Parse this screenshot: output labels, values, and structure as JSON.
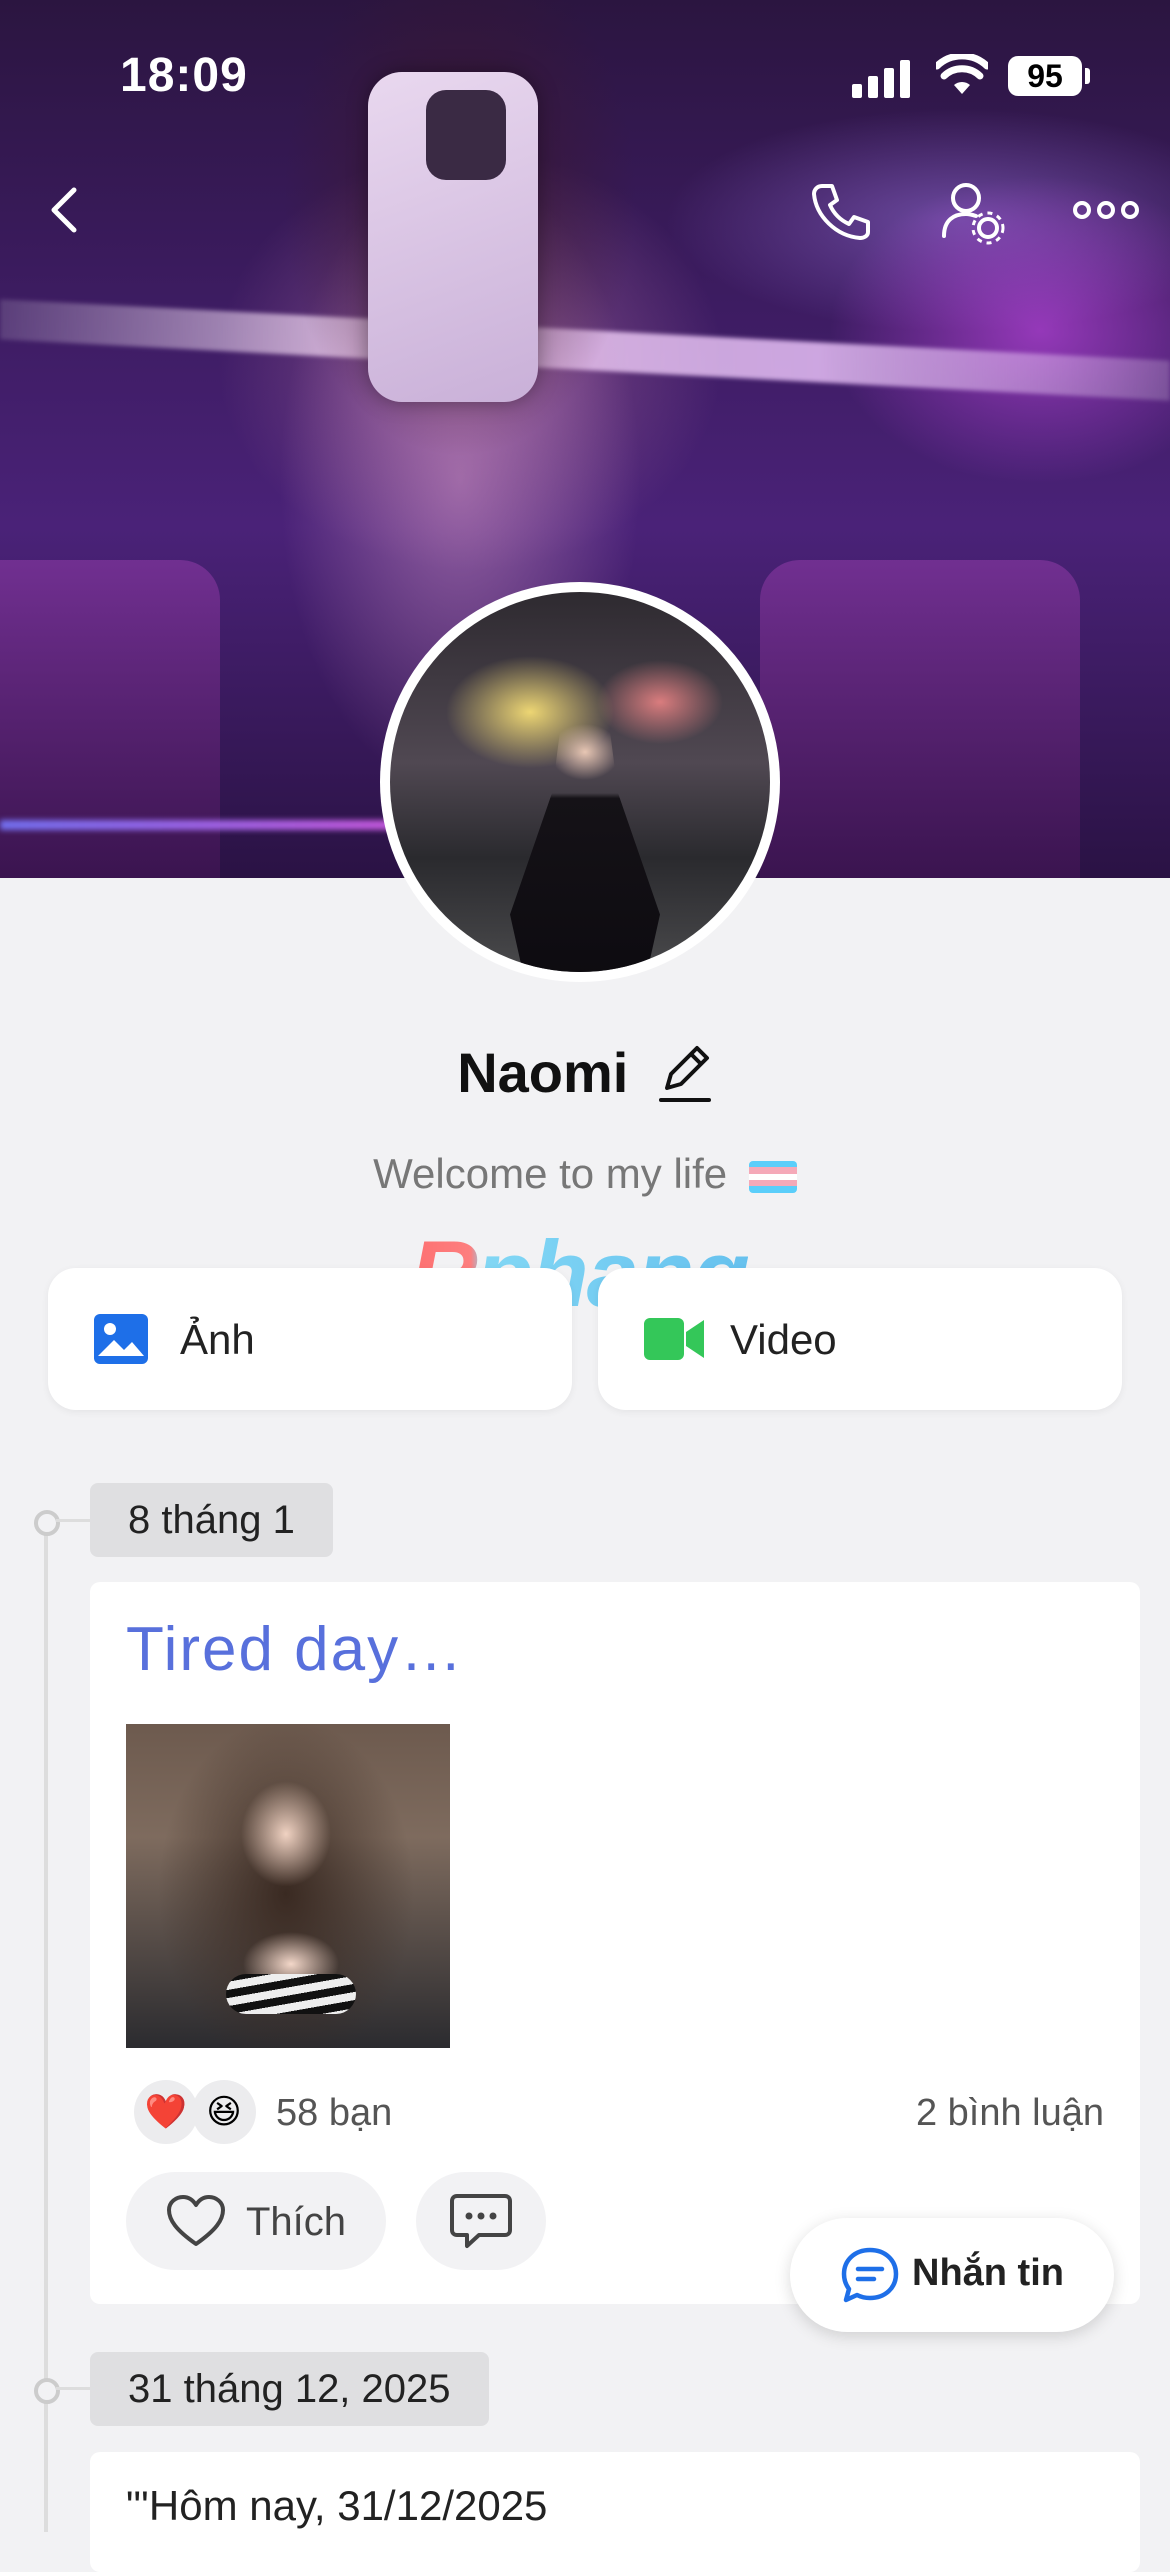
{
  "status_bar": {
    "time": "18:09",
    "battery": "95"
  },
  "profile": {
    "name": "Naomi",
    "bio": "Welcome to my life"
  },
  "watermark": "Rphang",
  "tabs": [
    {
      "label": "Ảnh"
    },
    {
      "label": "Video"
    }
  ],
  "timeline": [
    {
      "date": "8 tháng 1",
      "title": "Tired day…",
      "reactions": {
        "count_label": "58 bạn"
      },
      "comments_label": "2 bình luận",
      "like_label": "Thích"
    },
    {
      "date": "31 tháng 12, 2025",
      "text": "\"'Hôm nay, 31/12/2025"
    }
  ],
  "message_button": {
    "label": "Nhắn tin"
  },
  "colors": {
    "accent": "#5870dc",
    "link_blue": "#1e6fe8",
    "video_green": "#34c759"
  }
}
